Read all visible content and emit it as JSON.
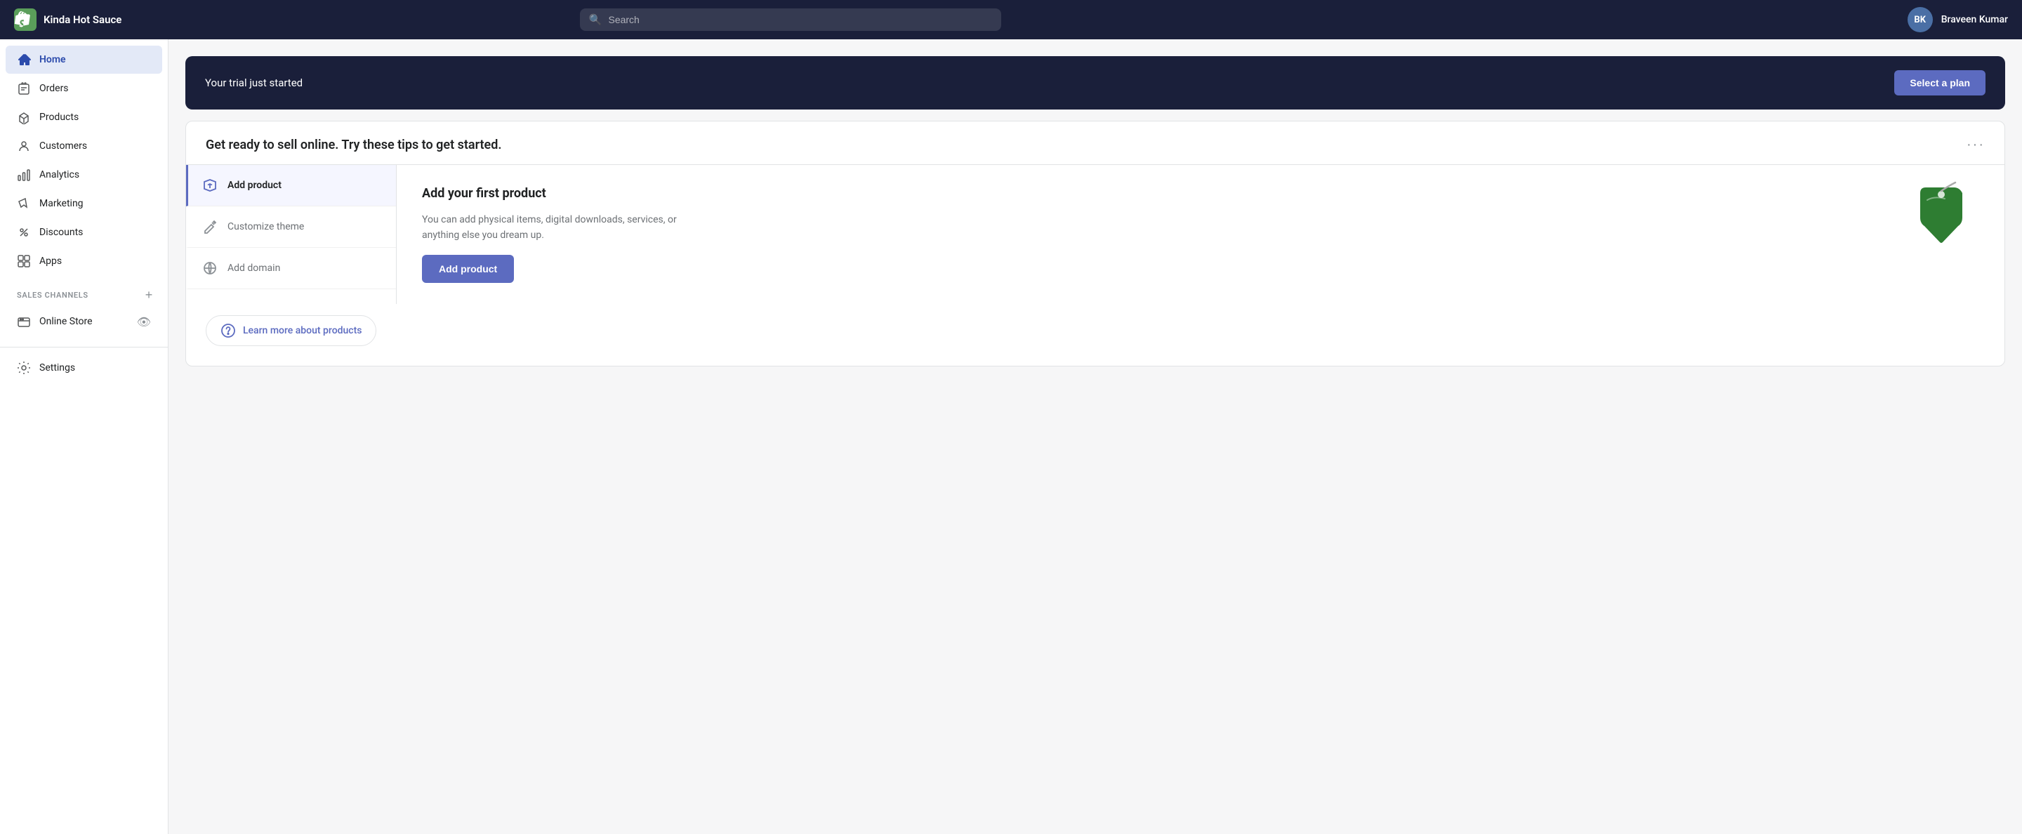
{
  "brand": {
    "store_name": "Kinda Hot Sauce",
    "logo_bg": "#5a9e5a"
  },
  "topnav": {
    "search_placeholder": "Search",
    "user_initials": "BK",
    "user_name": "Braveen Kumar"
  },
  "sidebar": {
    "items": [
      {
        "id": "home",
        "label": "Home",
        "active": true
      },
      {
        "id": "orders",
        "label": "Orders",
        "active": false
      },
      {
        "id": "products",
        "label": "Products",
        "active": false
      },
      {
        "id": "customers",
        "label": "Customers",
        "active": false
      },
      {
        "id": "analytics",
        "label": "Analytics",
        "active": false
      },
      {
        "id": "marketing",
        "label": "Marketing",
        "active": false
      },
      {
        "id": "discounts",
        "label": "Discounts",
        "active": false
      },
      {
        "id": "apps",
        "label": "Apps",
        "active": false
      }
    ],
    "sales_channels_label": "SALES CHANNELS",
    "online_store_label": "Online Store",
    "settings_label": "Settings"
  },
  "trial_banner": {
    "text": "Your trial just started",
    "button_label": "Select a plan"
  },
  "tips_card": {
    "title": "Get ready to sell online. Try these tips to get started.",
    "tips": [
      {
        "id": "add-product",
        "label": "Add product",
        "active": true
      },
      {
        "id": "customize-theme",
        "label": "Customize theme",
        "active": false
      },
      {
        "id": "add-domain",
        "label": "Add domain",
        "active": false
      }
    ],
    "detail": {
      "title": "Add your first product",
      "description": "You can add physical items, digital downloads, services, or anything else you dream up.",
      "button_label": "Add product"
    },
    "learn_more": {
      "label": "Learn more about products"
    }
  }
}
